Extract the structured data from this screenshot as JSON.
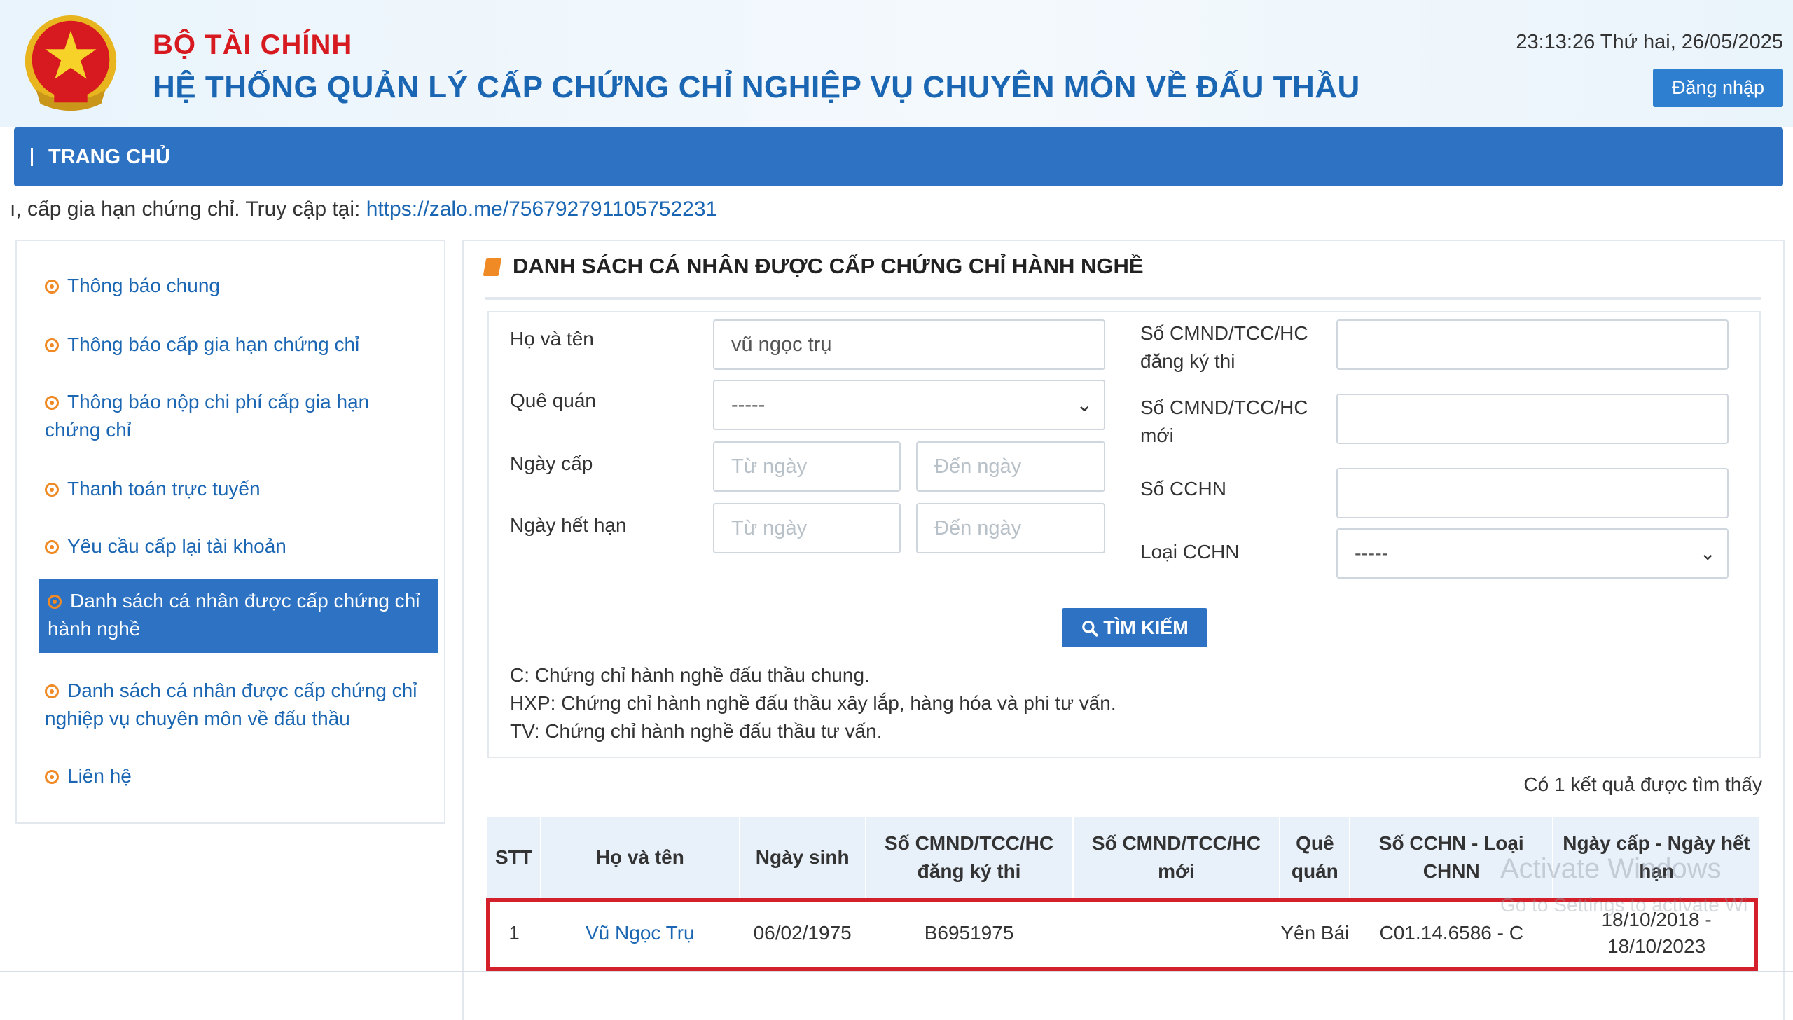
{
  "header": {
    "org_name": "BỘ TÀI CHÍNH",
    "system_name": "HỆ THỐNG QUẢN LÝ CẤP CHỨNG CHỈ NGHIỆP VỤ CHUYÊN MÔN VỀ ĐẤU THẦU",
    "datetime": "23:13:26 Thứ hai, 26/05/2025",
    "login_label": "Đăng nhập"
  },
  "nav": {
    "home": "TRANG CHỦ"
  },
  "marquee": {
    "text": "ı, cấp gia hạn chứng chỉ. Truy cập tại: ",
    "link": "https://zalo.me/756792791105752231"
  },
  "sidebar": {
    "items": [
      {
        "label": "Thông báo chung"
      },
      {
        "label": "Thông báo cấp gia hạn chứng chỉ"
      },
      {
        "label": "Thông báo nộp chi phí cấp gia hạn chứng chỉ"
      },
      {
        "label": "Thanh toán trực tuyến"
      },
      {
        "label": "Yêu cầu cấp lại tài khoản"
      },
      {
        "label": "Danh sách cá nhân được cấp chứng chỉ hành nghề"
      },
      {
        "label": "Danh sách cá nhân được cấp chứng chỉ nghiệp vụ chuyên môn về đấu thầu"
      },
      {
        "label": "Liên hệ"
      }
    ],
    "active_index": 5
  },
  "content": {
    "title": "DANH SÁCH CÁ NHÂN ĐƯỢC CẤP CHỨNG CHỈ HÀNH NGHỀ"
  },
  "search": {
    "name_label": "Họ và tên",
    "name_value": "vũ ngọc trụ",
    "hometown_label": "Quê quán",
    "hometown_value": "-----",
    "issue_date_label": "Ngày cấp",
    "expiry_date_label": "Ngày hết hạn",
    "from_placeholder": "Từ ngày",
    "to_placeholder": "Đến ngày",
    "id_exam_label": "Số CMND/TCC/HC đăng ký thi",
    "id_new_label": "Số CMND/TCC/HC mới",
    "cert_no_label": "Số CCHN",
    "cert_type_label": "Loại CCHN",
    "cert_type_value": "-----",
    "button_label": "TÌM KIẾM",
    "notes": [
      "C: Chứng chỉ hành nghề đấu thầu chung.",
      "HXP: Chứng chỉ hành nghề đấu thầu xây lắp, hàng hóa và phi tư vấn.",
      "TV: Chứng chỉ hành nghề đấu thầu tư vấn."
    ]
  },
  "results": {
    "count_text": "Có 1 kết quả được tìm thấy",
    "headers": [
      "STT",
      "Họ và tên",
      "Ngày sinh",
      "Số CMND/TCC/HC đăng ký thi",
      "Số CMND/TCC/HC mới",
      "Quê quán",
      "Số CCHN - Loại CHNN",
      "Ngày cấp - Ngày hết hạn"
    ],
    "rows": [
      {
        "stt": "1",
        "name": "Vũ Ngọc Trụ",
        "dob": "06/02/1975",
        "id_exam": "B6951975",
        "id_new": "",
        "hometown": "Yên Bái",
        "cert": "C01.14.6586 - C",
        "dates": "18/10/2018 - 18/10/2023"
      }
    ]
  },
  "watermark": {
    "line1": "Activate Windows",
    "line2": "Go to Settings to activate Wi"
  },
  "colors": {
    "brand_blue": "#2e73c3",
    "title_red": "#d71920",
    "accent_orange": "#f08a24",
    "highlight_red": "#d4202a"
  }
}
